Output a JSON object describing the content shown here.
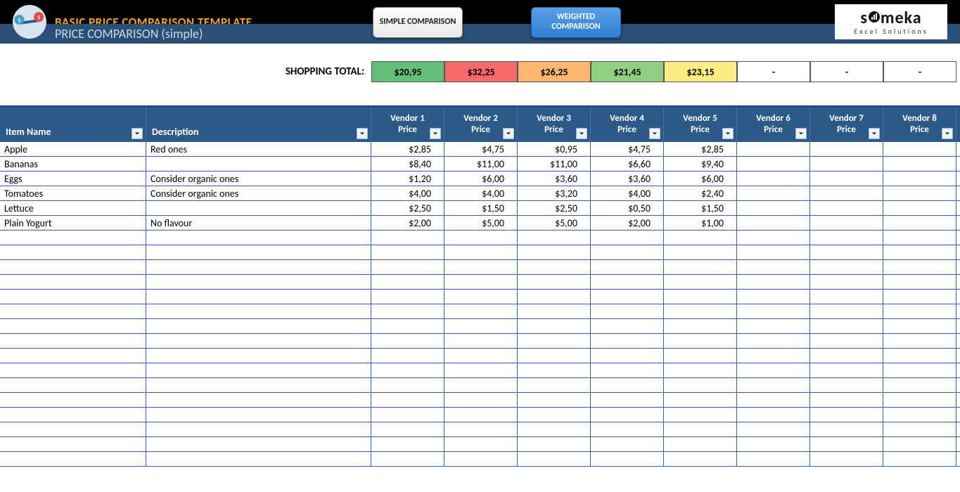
{
  "header": {
    "template_title": "BASIC PRICE COMPARISON TEMPLATE",
    "subtitle_main": "PRICE COMPARISON",
    "subtitle_note": "(simple)",
    "nav_simple": "SIMPLE COMPARISON",
    "nav_weighted": "WEIGHTED COMPARISON",
    "logo_main": "someka",
    "logo_sub": "Excel Solutions"
  },
  "totals": {
    "label": "SHOPPING TOTAL:",
    "cells": [
      {
        "value": "$20,95",
        "cls": "c-green"
      },
      {
        "value": "$32,25",
        "cls": "c-red"
      },
      {
        "value": "$26,25",
        "cls": "c-orange"
      },
      {
        "value": "$21,45",
        "cls": "c-lgreen"
      },
      {
        "value": "$23,15",
        "cls": "c-yellow"
      },
      {
        "value": "-",
        "cls": "c-dash"
      },
      {
        "value": "-",
        "cls": "c-dash"
      },
      {
        "value": "-",
        "cls": "c-dash"
      }
    ]
  },
  "columns": {
    "item": "Item Name",
    "desc": "Description",
    "vendors": [
      {
        "name": "Vendor 1",
        "price": "Price"
      },
      {
        "name": "Vendor 2",
        "price": "Price"
      },
      {
        "name": "Vendor 3",
        "price": "Price"
      },
      {
        "name": "Vendor 4",
        "price": "Price"
      },
      {
        "name": "Vendor 5",
        "price": "Price"
      },
      {
        "name": "Vendor 6",
        "price": "Price"
      },
      {
        "name": "Vendor 7",
        "price": "Price"
      },
      {
        "name": "Vendor 8",
        "price": "Price"
      }
    ]
  },
  "rows": [
    {
      "item": "Apple",
      "desc": "Red ones",
      "p": [
        "$2,85",
        "$4,75",
        "$0,95",
        "$4,75",
        "$2,85",
        "",
        "",
        ""
      ]
    },
    {
      "item": "Bananas",
      "desc": "",
      "p": [
        "$8,40",
        "$11,00",
        "$11,00",
        "$6,60",
        "$9,40",
        "",
        "",
        ""
      ]
    },
    {
      "item": "Eggs",
      "desc": "Consider organic ones",
      "p": [
        "$1,20",
        "$6,00",
        "$3,60",
        "$3,60",
        "$6,00",
        "",
        "",
        ""
      ]
    },
    {
      "item": "Tomatoes",
      "desc": "Consider organic ones",
      "p": [
        "$4,00",
        "$4,00",
        "$3,20",
        "$4,00",
        "$2,40",
        "",
        "",
        ""
      ]
    },
    {
      "item": "Lettuce",
      "desc": "",
      "p": [
        "$2,50",
        "$1,50",
        "$2,50",
        "$0,50",
        "$1,50",
        "",
        "",
        ""
      ]
    },
    {
      "item": "Plain Yogurt",
      "desc": "No flavour",
      "p": [
        "$2,00",
        "$5,00",
        "$5,00",
        "$2,00",
        "$1,00",
        "",
        "",
        ""
      ]
    },
    {
      "item": "",
      "desc": "",
      "p": [
        "",
        "",
        "",
        "",
        "",
        "",
        "",
        ""
      ]
    },
    {
      "item": "",
      "desc": "",
      "p": [
        "",
        "",
        "",
        "",
        "",
        "",
        "",
        ""
      ]
    },
    {
      "item": "",
      "desc": "",
      "p": [
        "",
        "",
        "",
        "",
        "",
        "",
        "",
        ""
      ]
    },
    {
      "item": "",
      "desc": "",
      "p": [
        "",
        "",
        "",
        "",
        "",
        "",
        "",
        ""
      ]
    },
    {
      "item": "",
      "desc": "",
      "p": [
        "",
        "",
        "",
        "",
        "",
        "",
        "",
        ""
      ]
    },
    {
      "item": "",
      "desc": "",
      "p": [
        "",
        "",
        "",
        "",
        "",
        "",
        "",
        ""
      ]
    },
    {
      "item": "",
      "desc": "",
      "p": [
        "",
        "",
        "",
        "",
        "",
        "",
        "",
        ""
      ]
    },
    {
      "item": "",
      "desc": "",
      "p": [
        "",
        "",
        "",
        "",
        "",
        "",
        "",
        ""
      ]
    },
    {
      "item": "",
      "desc": "",
      "p": [
        "",
        "",
        "",
        "",
        "",
        "",
        "",
        ""
      ]
    },
    {
      "item": "",
      "desc": "",
      "p": [
        "",
        "",
        "",
        "",
        "",
        "",
        "",
        ""
      ]
    },
    {
      "item": "",
      "desc": "",
      "p": [
        "",
        "",
        "",
        "",
        "",
        "",
        "",
        ""
      ]
    },
    {
      "item": "",
      "desc": "",
      "p": [
        "",
        "",
        "",
        "",
        "",
        "",
        "",
        ""
      ]
    },
    {
      "item": "",
      "desc": "",
      "p": [
        "",
        "",
        "",
        "",
        "",
        "",
        "",
        ""
      ]
    },
    {
      "item": "",
      "desc": "",
      "p": [
        "",
        "",
        "",
        "",
        "",
        "",
        "",
        ""
      ]
    },
    {
      "item": "",
      "desc": "",
      "p": [
        "",
        "",
        "",
        "",
        "",
        "",
        "",
        ""
      ]
    },
    {
      "item": "",
      "desc": "",
      "p": [
        "",
        "",
        "",
        "",
        "",
        "",
        "",
        ""
      ]
    }
  ]
}
